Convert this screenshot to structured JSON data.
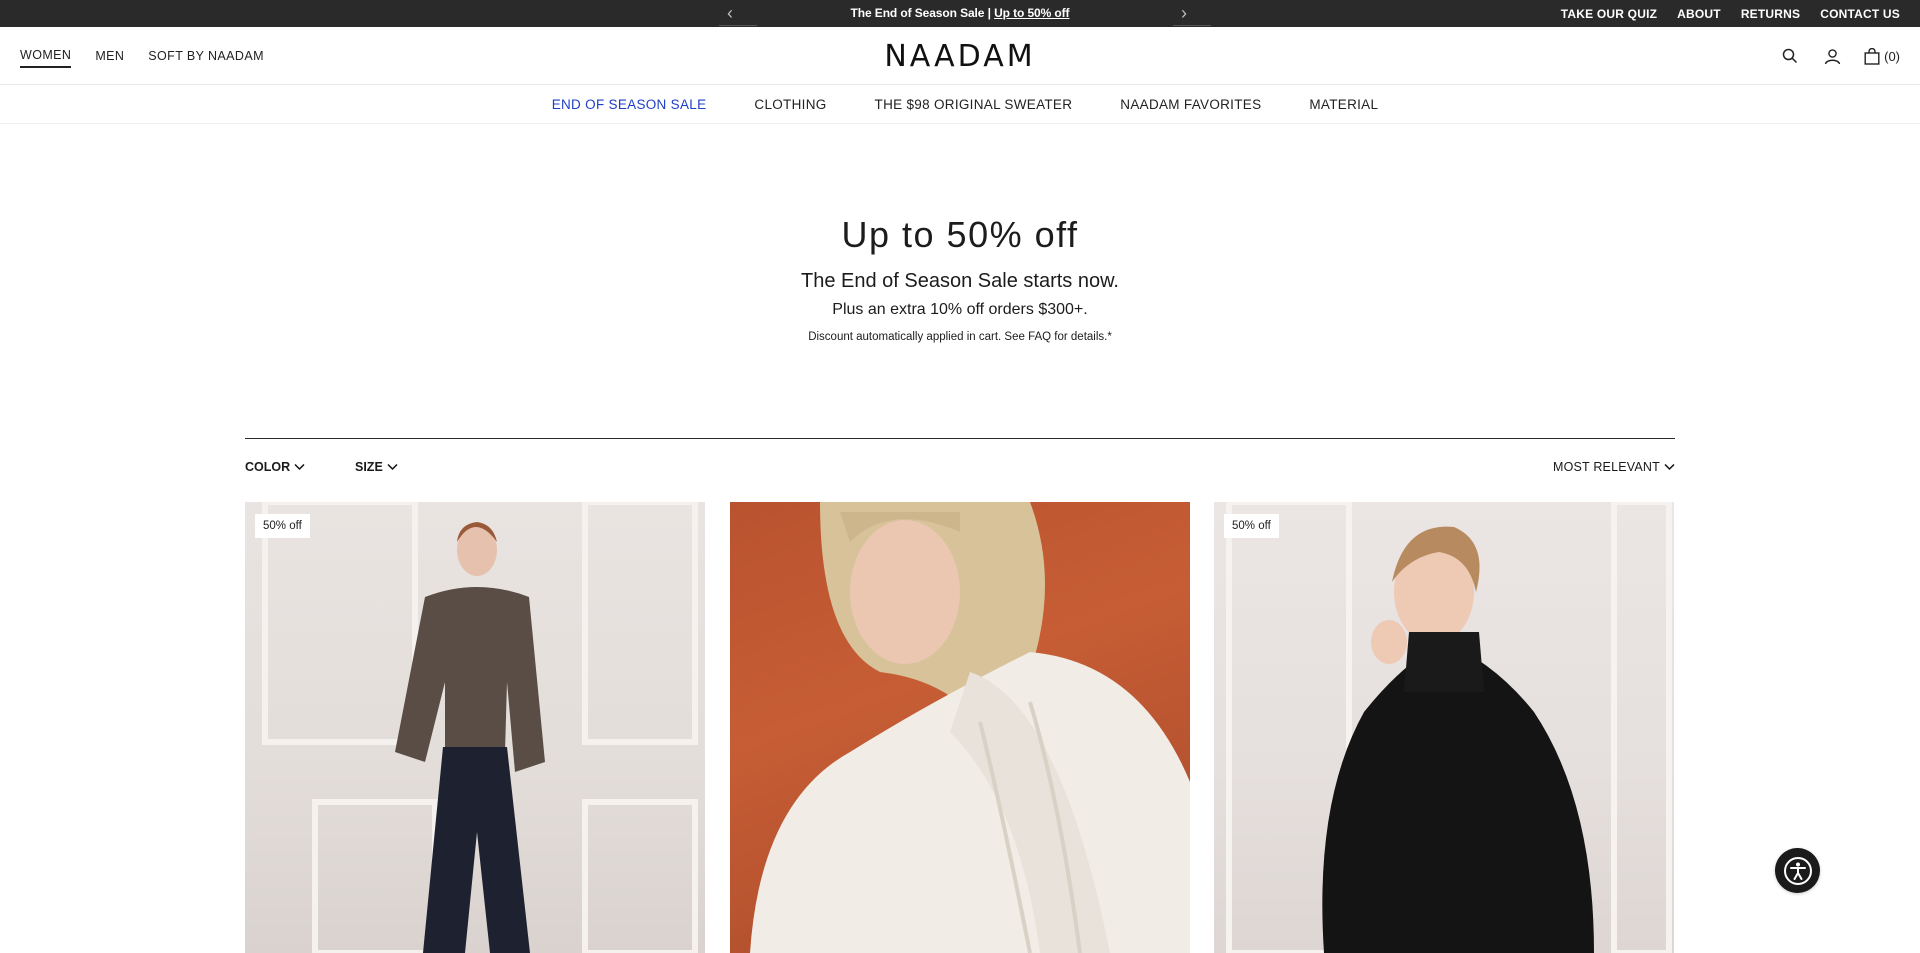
{
  "announcement": {
    "prev": "‹",
    "next": "›",
    "text": "The End of Season Sale |",
    "link": "Up to 50% off",
    "utility_links": [
      "TAKE OUR QUIZ",
      "ABOUT",
      "RETURNS",
      "CONTACT US"
    ]
  },
  "header": {
    "gender_nav": [
      "WOMEN",
      "MEN",
      "SOFT BY NAADAM"
    ],
    "logo": "NAADAM",
    "cart_count": "(0)"
  },
  "category_nav": [
    "END OF SEASON SALE",
    "CLOTHING",
    "THE $98 ORIGINAL SWEATER",
    "NAADAM FAVORITES",
    "MATERIAL"
  ],
  "hero": {
    "title": "Up to 50% off",
    "subtitle": "The End of Season Sale starts now.",
    "extra": "Plus an extra 10% off orders $300+.",
    "note": "Discount automatically applied in cart. See FAQ for details.*"
  },
  "filters": {
    "color": "COLOR",
    "size": "SIZE",
    "sort": "MOST RELEVANT"
  },
  "products": [
    {
      "badge": "50% off"
    },
    {
      "badge": ""
    },
    {
      "badge": "50% off"
    }
  ],
  "colors": {
    "announcement_bg": "#2a2a2a",
    "sale_link": "#1f3fc7"
  }
}
